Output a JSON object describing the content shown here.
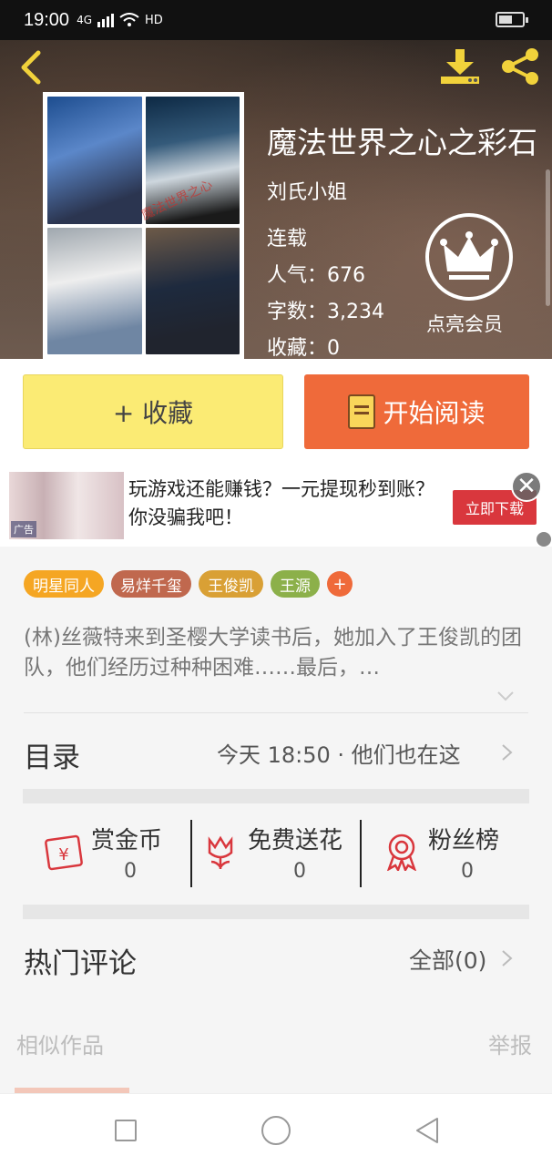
{
  "status_bar": {
    "time": "19:00",
    "network": "4G",
    "hd": "HD"
  },
  "book": {
    "title": "魔法世界之心之彩石",
    "author": "刘氏小姐",
    "status": "连载",
    "popularity": "人气：676",
    "word_count": "字数：3,234",
    "favorites": "收藏：0",
    "cover_watermark": "魔法世界之心"
  },
  "vip": {
    "label": "点亮会员"
  },
  "actions": {
    "favorite": "+ 收藏",
    "read": "开始阅读"
  },
  "ad": {
    "text": "玩游戏还能赚钱？一元提现秒到账？你没骗我吧！",
    "button": "立即下载",
    "tag": "广告"
  },
  "tags": [
    {
      "label": "明星同人",
      "color": "#f5a623"
    },
    {
      "label": "易烊千玺",
      "color": "#c0684e"
    },
    {
      "label": "王俊凯",
      "color": "#d9a035"
    },
    {
      "label": "王源",
      "color": "#8cb04a"
    }
  ],
  "tags_more": "+",
  "description": "(林)丝薇特来到圣樱大学读书后，她加入了王俊凯的团队，他们经历过种种困难……最后，…",
  "catalog": {
    "label": "目录",
    "latest": "今天 18:50 · 他们也在这"
  },
  "stats": [
    {
      "label": "赏金币",
      "value": "0",
      "icon": "red-envelope-icon"
    },
    {
      "label": "免费送花",
      "value": "0",
      "icon": "flower-icon"
    },
    {
      "label": "粉丝榜",
      "value": "0",
      "icon": "medal-icon"
    }
  ],
  "comments": {
    "label": "热门评论",
    "all": "全部(0)"
  },
  "similar": {
    "label": "相似作品",
    "report": "举报"
  },
  "colors": {
    "accent": "#ef6a3a",
    "favorite_bg": "#fbeb74",
    "icon_yellow": "#f1d23b",
    "stat_red": "#d9373d"
  }
}
